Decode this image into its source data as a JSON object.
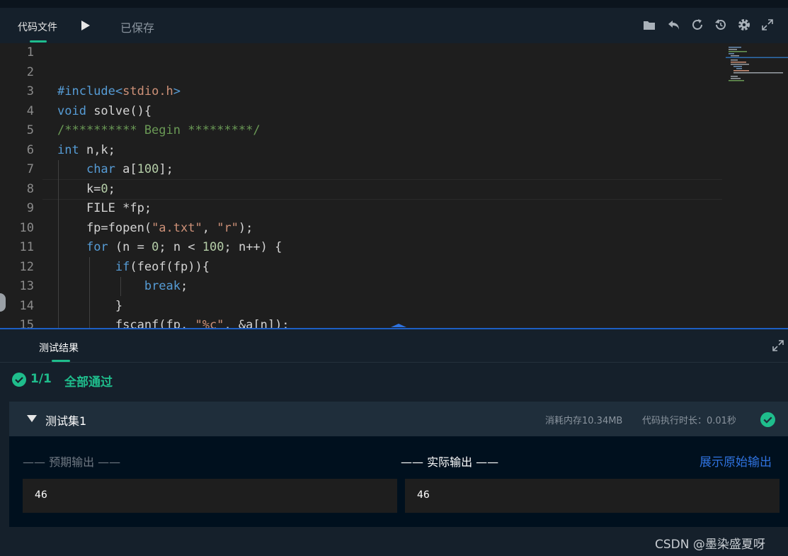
{
  "toolbar": {
    "code_tab": "代码文件",
    "saved_status": "已保存",
    "icons": [
      "folder-icon",
      "undo-icon",
      "refresh-icon",
      "history-icon",
      "gear-icon",
      "fullscreen-icon"
    ]
  },
  "editor": {
    "line_numbers": [
      "1",
      "2",
      "3",
      "4",
      "5",
      "6",
      "7",
      "8",
      "9",
      "10",
      "11",
      "12",
      "13",
      "14",
      "15"
    ],
    "lines": [
      "",
      "",
      "#include<stdio.h>",
      "void solve(){",
      "/********** Begin *********/",
      "int n,k;",
      "    char a[100];",
      "    k=0;",
      "    FILE *fp;",
      "    fp=fopen(\"a.txt\", \"r\");",
      "    for (n = 0; n < 100; n++) {",
      "        if(feof(fp)){",
      "            break;",
      "        }",
      "        fscanf(fp, \"%c\", &a[n]);"
    ]
  },
  "results": {
    "tab_label": "测试结果",
    "pass_count": "1/1",
    "pass_message": "全部通过",
    "suite": {
      "title": "测试集1",
      "memory": "消耗内存10.34MB",
      "exec_time": "代码执行时长：0.01秒",
      "expected_label": "—— 预期输出 ——",
      "actual_label": "—— 实际输出 ——",
      "show_raw_link": "展示原始输出",
      "expected_output": "46",
      "actual_output": "46"
    }
  },
  "watermark": "CSDN @墨染盛夏呀",
  "colors": {
    "accent_green": "#1fbd8c",
    "link_blue": "#2f73e0",
    "splitter_blue": "#1d5ec4"
  }
}
